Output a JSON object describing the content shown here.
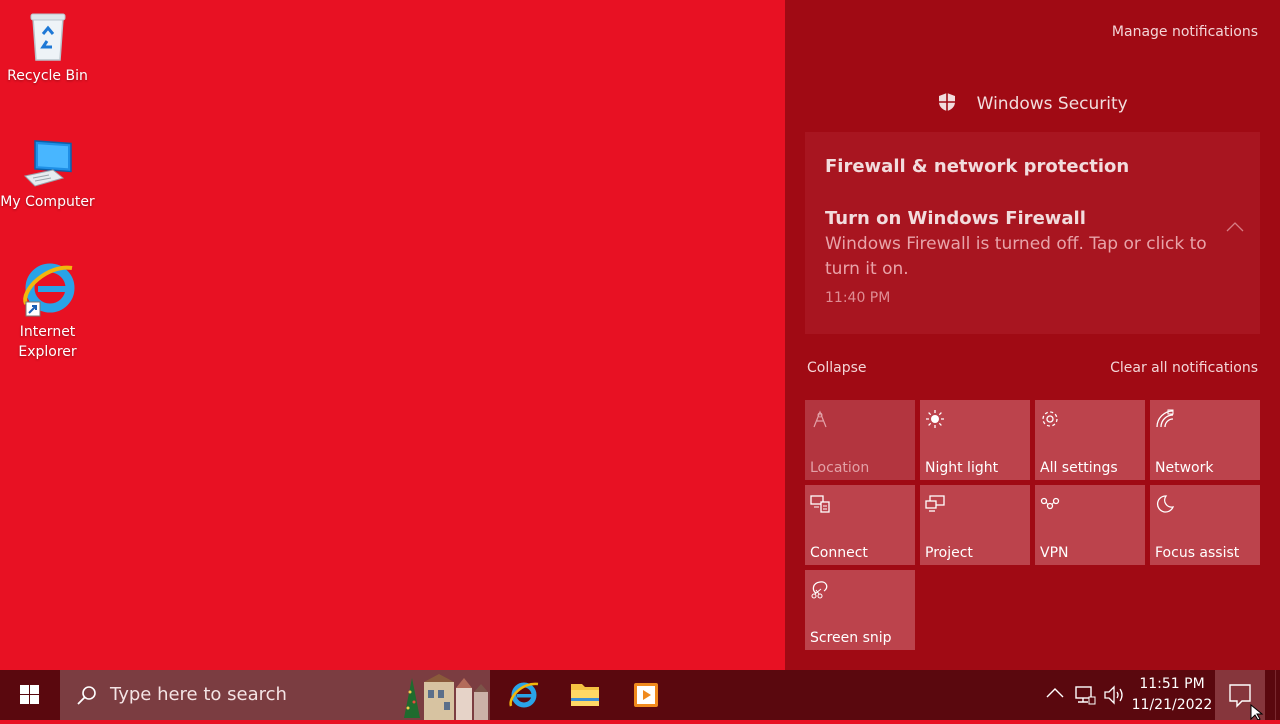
{
  "desktop": {
    "icons": [
      {
        "label": "Recycle Bin",
        "icon": "recycle-bin-icon"
      },
      {
        "label": "My Computer",
        "icon": "computer-icon"
      },
      {
        "label": "Internet Explorer",
        "icon": "internet-explorer-icon"
      }
    ],
    "background_color": "#e81123"
  },
  "action_center": {
    "manage_notifications": "Manage notifications",
    "group_title": "Windows Security",
    "notification": {
      "category": "Firewall & network protection",
      "title": "Turn on Windows Firewall",
      "body": "Windows Firewall is turned off. Tap or click to turn it on.",
      "time": "11:40 PM"
    },
    "collapse": "Collapse",
    "clear_all": "Clear all notifications",
    "quick_actions": [
      {
        "label": "Location",
        "icon": "location-icon",
        "enabled": false
      },
      {
        "label": "Night light",
        "icon": "brightness-icon",
        "enabled": true
      },
      {
        "label": "All settings",
        "icon": "gear-icon",
        "enabled": true
      },
      {
        "label": "Network",
        "icon": "network-icon",
        "enabled": true
      },
      {
        "label": "Connect",
        "icon": "connect-icon",
        "enabled": true
      },
      {
        "label": "Project",
        "icon": "project-icon",
        "enabled": true
      },
      {
        "label": "VPN",
        "icon": "vpn-icon",
        "enabled": true
      },
      {
        "label": "Focus assist",
        "icon": "moon-icon",
        "enabled": true
      },
      {
        "label": "Screen snip",
        "icon": "screen-snip-icon",
        "enabled": true
      }
    ],
    "panel_color": "#a00a14"
  },
  "taskbar": {
    "search_placeholder": "Type here to search",
    "pinned_apps": [
      "internet-explorer-icon",
      "file-explorer-icon",
      "media-player-icon"
    ],
    "clock": {
      "time": "11:51 PM",
      "date": "11/21/2022"
    }
  }
}
